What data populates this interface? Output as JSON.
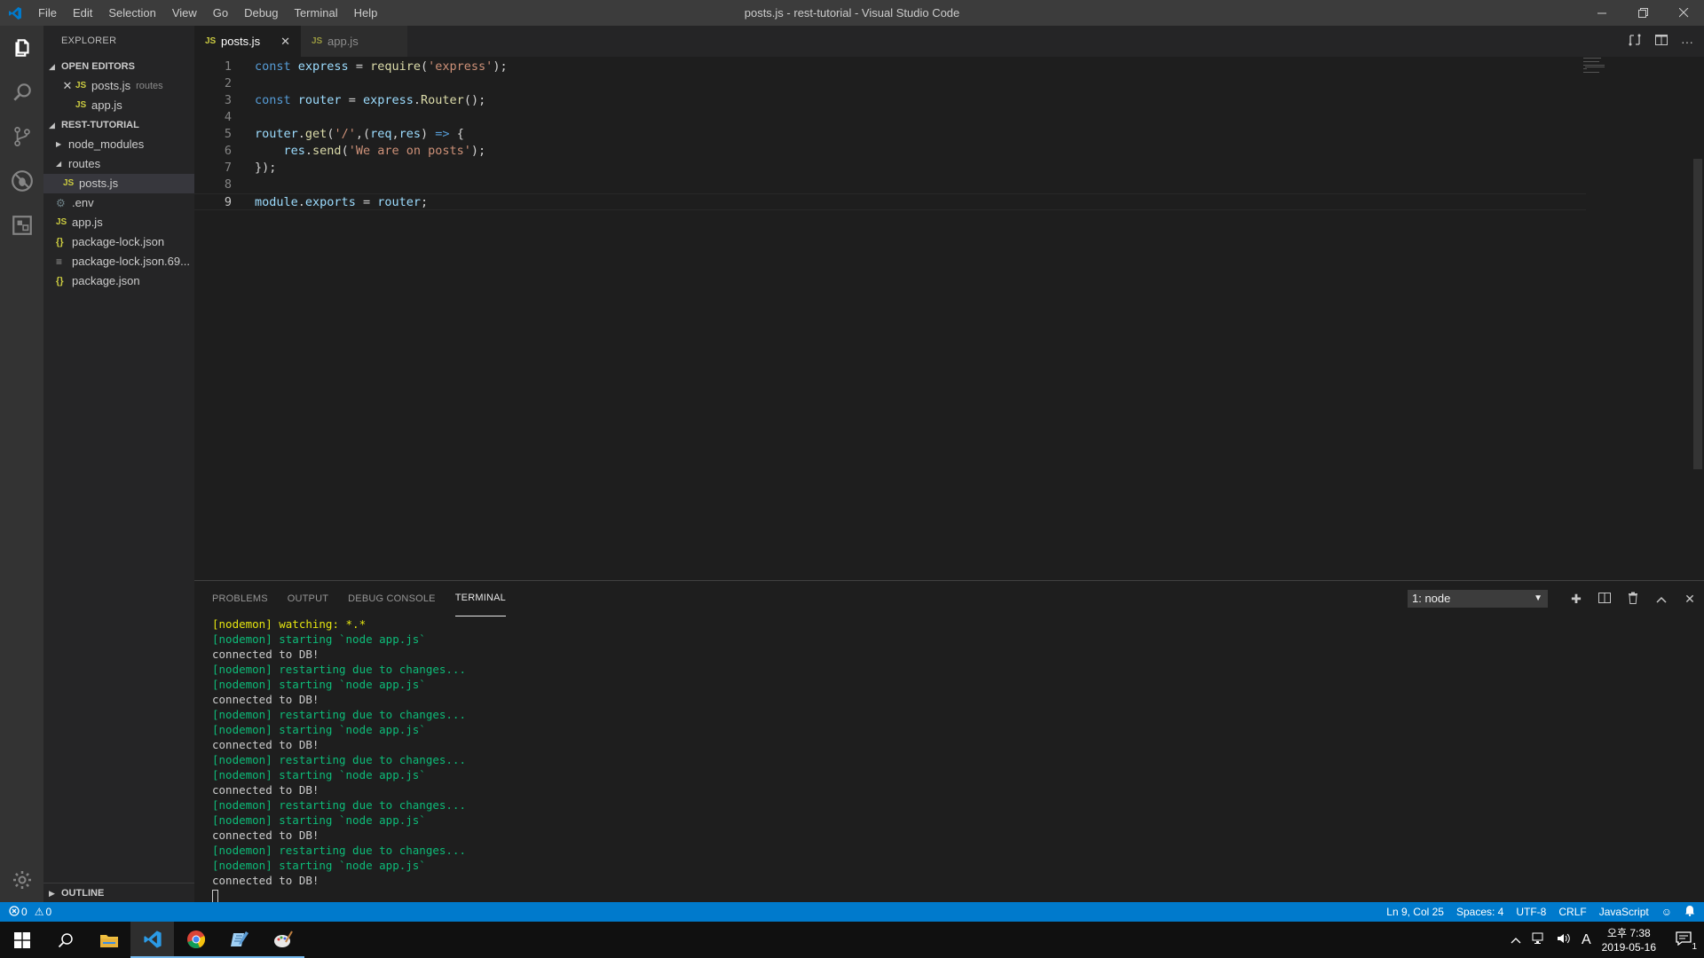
{
  "titlebar": {
    "menu": [
      "File",
      "Edit",
      "Selection",
      "View",
      "Go",
      "Debug",
      "Terminal",
      "Help"
    ],
    "title": "posts.js - rest-tutorial - Visual Studio Code"
  },
  "activitybar": {
    "icons": [
      "explorer-icon",
      "search-icon",
      "source-control-icon",
      "debug-icon",
      "extensions-icon",
      "gear-icon"
    ]
  },
  "sidebar": {
    "title": "EXPLORER",
    "open_editors": {
      "label": "OPEN EDITORS",
      "items": [
        {
          "name": "posts.js",
          "hint": "routes"
        },
        {
          "name": "app.js"
        }
      ]
    },
    "project": {
      "label": "REST-TUTORIAL",
      "folders": [
        "node_modules",
        "routes"
      ],
      "routes_child": "posts.js",
      "files": [
        ".env",
        "app.js",
        "package-lock.json",
        "package-lock.json.69...",
        "package.json"
      ]
    },
    "outline_label": "OUTLINE"
  },
  "tabs": [
    {
      "label": "posts.js",
      "active": true
    },
    {
      "label": "app.js",
      "active": false
    }
  ],
  "editor": {
    "line_numbers": [
      "1",
      "2",
      "3",
      "4",
      "5",
      "6",
      "7",
      "8",
      "9"
    ],
    "current_line": "9"
  },
  "panel": {
    "tabs": [
      "PROBLEMS",
      "OUTPUT",
      "DEBUG CONSOLE",
      "TERMINAL"
    ],
    "active_tab": "TERMINAL",
    "terminal_select": "1: node",
    "terminal_lines": [
      {
        "text": "[nodemon] watching: *.*",
        "color": "yellow"
      },
      {
        "text": "[nodemon] starting `node app.js`",
        "color": "green"
      },
      {
        "text": "connected to DB!",
        "color": "white"
      },
      {
        "text": "[nodemon] restarting due to changes...",
        "color": "green"
      },
      {
        "text": "[nodemon] starting `node app.js`",
        "color": "green"
      },
      {
        "text": "connected to DB!",
        "color": "white"
      },
      {
        "text": "[nodemon] restarting due to changes...",
        "color": "green"
      },
      {
        "text": "[nodemon] starting `node app.js`",
        "color": "green"
      },
      {
        "text": "connected to DB!",
        "color": "white"
      },
      {
        "text": "[nodemon] restarting due to changes...",
        "color": "green"
      },
      {
        "text": "[nodemon] starting `node app.js`",
        "color": "green"
      },
      {
        "text": "connected to DB!",
        "color": "white"
      },
      {
        "text": "[nodemon] restarting due to changes...",
        "color": "green"
      },
      {
        "text": "[nodemon] starting `node app.js`",
        "color": "green"
      },
      {
        "text": "connected to DB!",
        "color": "white"
      },
      {
        "text": "[nodemon] restarting due to changes...",
        "color": "green"
      },
      {
        "text": "[nodemon] starting `node app.js`",
        "color": "green"
      },
      {
        "text": "connected to DB!",
        "color": "white"
      }
    ]
  },
  "statusbar": {
    "errors": "0",
    "warnings": "0",
    "position": "Ln 9, Col 25",
    "spaces": "Spaces: 4",
    "encoding": "UTF-8",
    "eol": "CRLF",
    "language": "JavaScript"
  },
  "taskbar": {
    "time": "오후 7:38",
    "date": "2019-05-16",
    "ime": "A",
    "notification_count": "1"
  },
  "colors": {
    "accent": "#007acc",
    "keyword": "#569cd6",
    "variable": "#9cdcfe",
    "function": "#dcdcaa",
    "string": "#ce9178",
    "terminal_green": "#0dbc79",
    "terminal_yellow": "#e5e510"
  }
}
